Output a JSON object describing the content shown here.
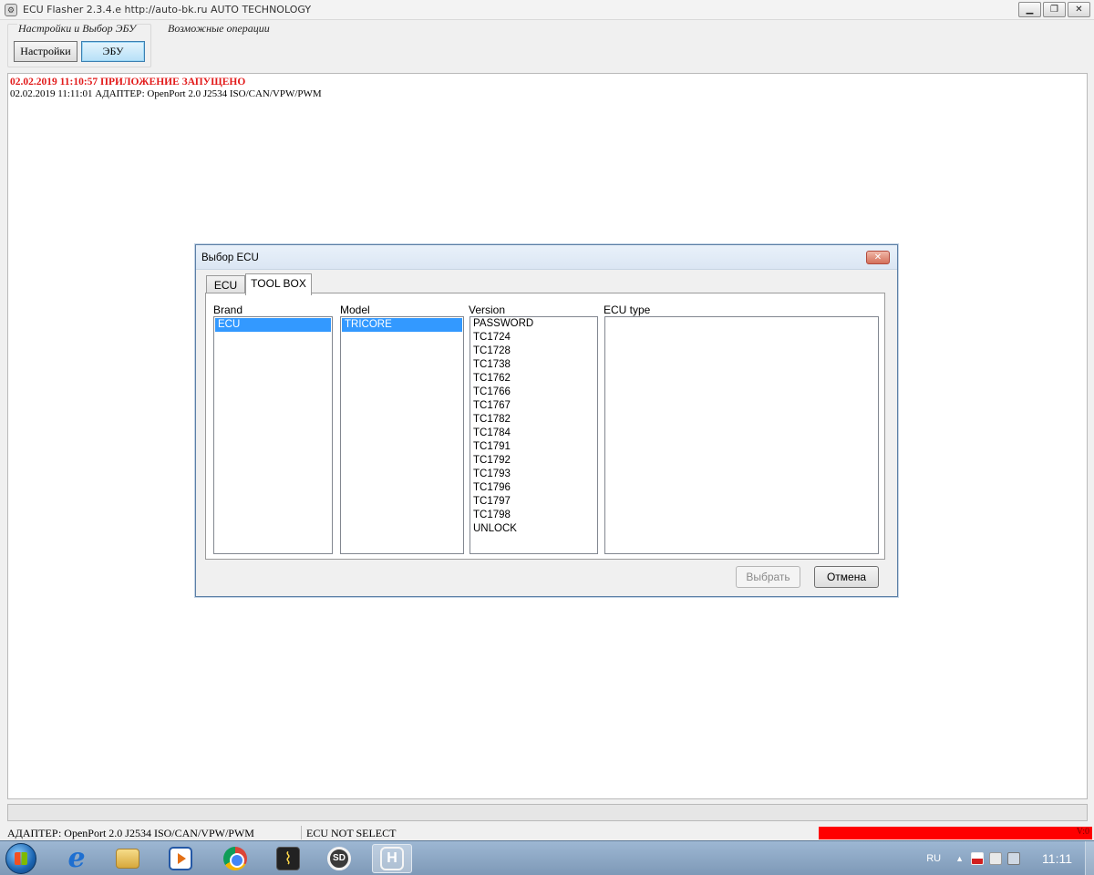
{
  "window": {
    "title": "ECU Flasher 2.3.4.e http://auto-bk.ru  AUTO TECHNOLOGY",
    "controls": [
      "minimize",
      "restore",
      "close"
    ]
  },
  "toolbar": {
    "group1_title": "Настройки и Выбор ЭБУ",
    "settings_label": "Настройки",
    "ecu_label": "ЭБУ",
    "group2_title": "Возможные операции"
  },
  "log": {
    "lines": [
      "02.02.2019 11:10:57 ПРИЛОЖЕНИЕ ЗАПУЩЕНО",
      "02.02.2019 11:11:01 АДАПТЕР: OpenPort 2.0 J2534 ISO/CAN/VPW/PWM"
    ]
  },
  "status": {
    "adapter": "АДАПТЕР: OpenPort 2.0 J2534 ISO/CAN/VPW/PWM",
    "ecu": "ECU NOT SELECT",
    "version": "V:0",
    "indicator_color": "#ff0000"
  },
  "dialog": {
    "title": "Выбор ECU",
    "tabs": [
      "ECU",
      "TOOL BOX"
    ],
    "active_tab": "TOOL BOX",
    "columns": {
      "brand": "Brand",
      "model": "Model",
      "version": "Version",
      "ecu_type": "ECU type"
    },
    "brand_items": [
      "ECU"
    ],
    "brand_selected": "ECU",
    "model_items": [
      "TRICORE"
    ],
    "model_selected": "TRICORE",
    "version_items": [
      "PASSWORD",
      "TC1724",
      "TC1728",
      "TC1738",
      "TC1762",
      "TC1766",
      "TC1767",
      "TC1782",
      "TC1784",
      "TC1791",
      "TC1792",
      "TC1793",
      "TC1796",
      "TC1797",
      "TC1798",
      "UNLOCK"
    ],
    "ecu_type_items": [],
    "select_label": "Выбрать",
    "cancel_label": "Отмена",
    "selection_color": "#3399ff"
  },
  "taskbar": {
    "items": [
      "start-button",
      "internet-explorer-icon",
      "file-explorer-icon",
      "media-player-icon",
      "chrome-icon",
      "oscilloscope-app-icon",
      "steering-wheel-app-icon",
      "honda-app-icon"
    ],
    "language": "RU",
    "time": "11:11"
  }
}
